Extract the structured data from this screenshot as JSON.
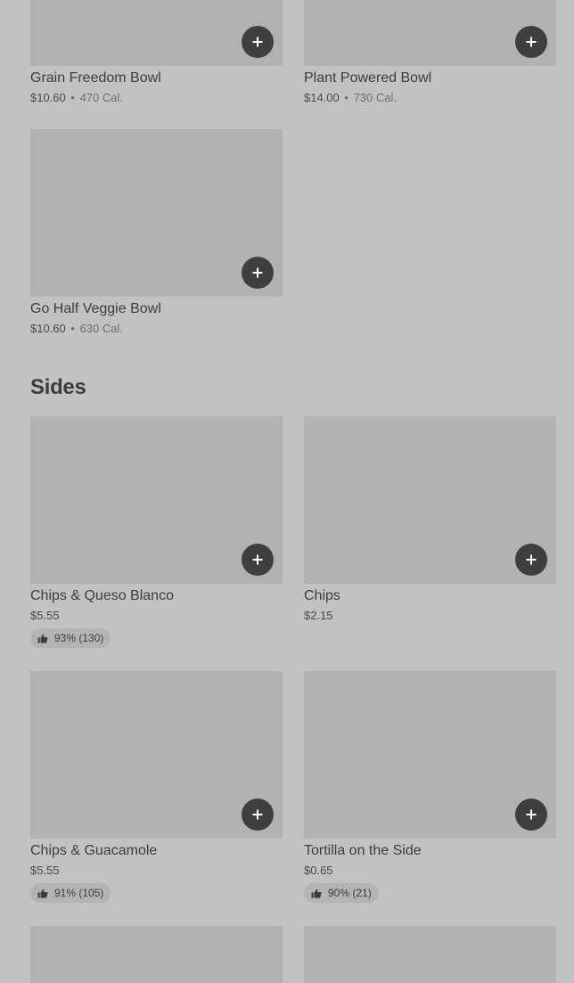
{
  "bowls": [
    {
      "name": "Grain Freedom Bowl",
      "price": "$10.60",
      "separator": "•",
      "calories": "470 Cal."
    },
    {
      "name": "Plant Powered Bowl",
      "price": "$14.00",
      "separator": "•",
      "calories": "730 Cal."
    },
    {
      "name": "Go Half Veggie Bowl",
      "price": "$10.60",
      "separator": "•",
      "calories": "630 Cal."
    }
  ],
  "sides_section": {
    "title": "Sides",
    "items": [
      {
        "name": "Chips & Queso Blanco",
        "price": "$5.55",
        "rating": "93% (130)"
      },
      {
        "name": "Chips",
        "price": "$2.15"
      },
      {
        "name": "Chips & Guacamole",
        "price": "$5.55",
        "rating": "91% (105)"
      },
      {
        "name": "Tortilla on the Side",
        "price": "$0.65",
        "rating": "90% (21)"
      }
    ]
  },
  "icons": {
    "add": "plus-icon",
    "rating": "thumbs-up-icon"
  },
  "colors": {
    "background": "#c2c2c2",
    "image_placeholder": "#b2b2b2",
    "add_button": "#3f3f3f",
    "rating_pill": "#b4b4b4",
    "text": "#3d3d3d"
  }
}
